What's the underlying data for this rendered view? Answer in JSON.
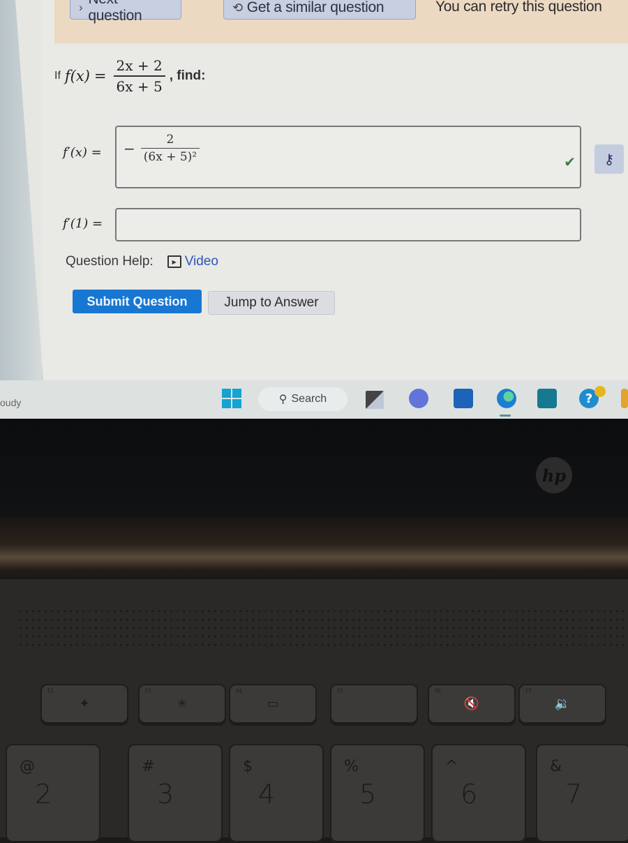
{
  "top_bar": {
    "next_question": "Next question",
    "similar_question": "Get a similar question",
    "retry_text": "You can retry this question"
  },
  "question": {
    "prefix": "If",
    "function_label": "f(x)",
    "equals": "=",
    "numerator": "2x + 2",
    "denominator": "6x + 5",
    "suffix": ", find:"
  },
  "parts": [
    {
      "label": "f′(x) =",
      "answer": {
        "sign": "−",
        "numerator": "2",
        "denominator": "(6x + 5)²"
      },
      "status": "correct"
    },
    {
      "label": "f′(1) =",
      "answer_value": ""
    }
  ],
  "help": {
    "label": "Question Help:",
    "video_link": "Video"
  },
  "actions": {
    "submit": "Submit Question",
    "jump": "Jump to Answer"
  },
  "taskbar": {
    "weather_text": "oudy",
    "search_label": "Search",
    "icons": [
      "start-icon",
      "search-icon",
      "task-view-icon",
      "meet-icon",
      "store-icon",
      "edge-icon",
      "photos-icon",
      "help-icon"
    ]
  },
  "laptop": {
    "brand": "hp",
    "function_keys": [
      {
        "label": "f2",
        "glyph": "✦"
      },
      {
        "label": "f3",
        "glyph": "✳"
      },
      {
        "label": "f4",
        "glyph": "▭"
      },
      {
        "label": "f5",
        "glyph": ""
      },
      {
        "label": "f6",
        "glyph": "🔇"
      },
      {
        "label": "f7",
        "glyph": "🔉"
      }
    ],
    "number_keys": [
      {
        "symbol": "@",
        "digit": "2"
      },
      {
        "symbol": "#",
        "digit": "3"
      },
      {
        "symbol": "$",
        "digit": "4"
      },
      {
        "symbol": "%",
        "digit": "5"
      },
      {
        "symbol": "^",
        "digit": "6"
      },
      {
        "symbol": "&",
        "digit": "7"
      }
    ]
  },
  "colors": {
    "submit_bg": "#1877d2",
    "link": "#2f55b8",
    "correct": "#3d7a4a",
    "top_bar_bg": "#ecd9c2"
  }
}
